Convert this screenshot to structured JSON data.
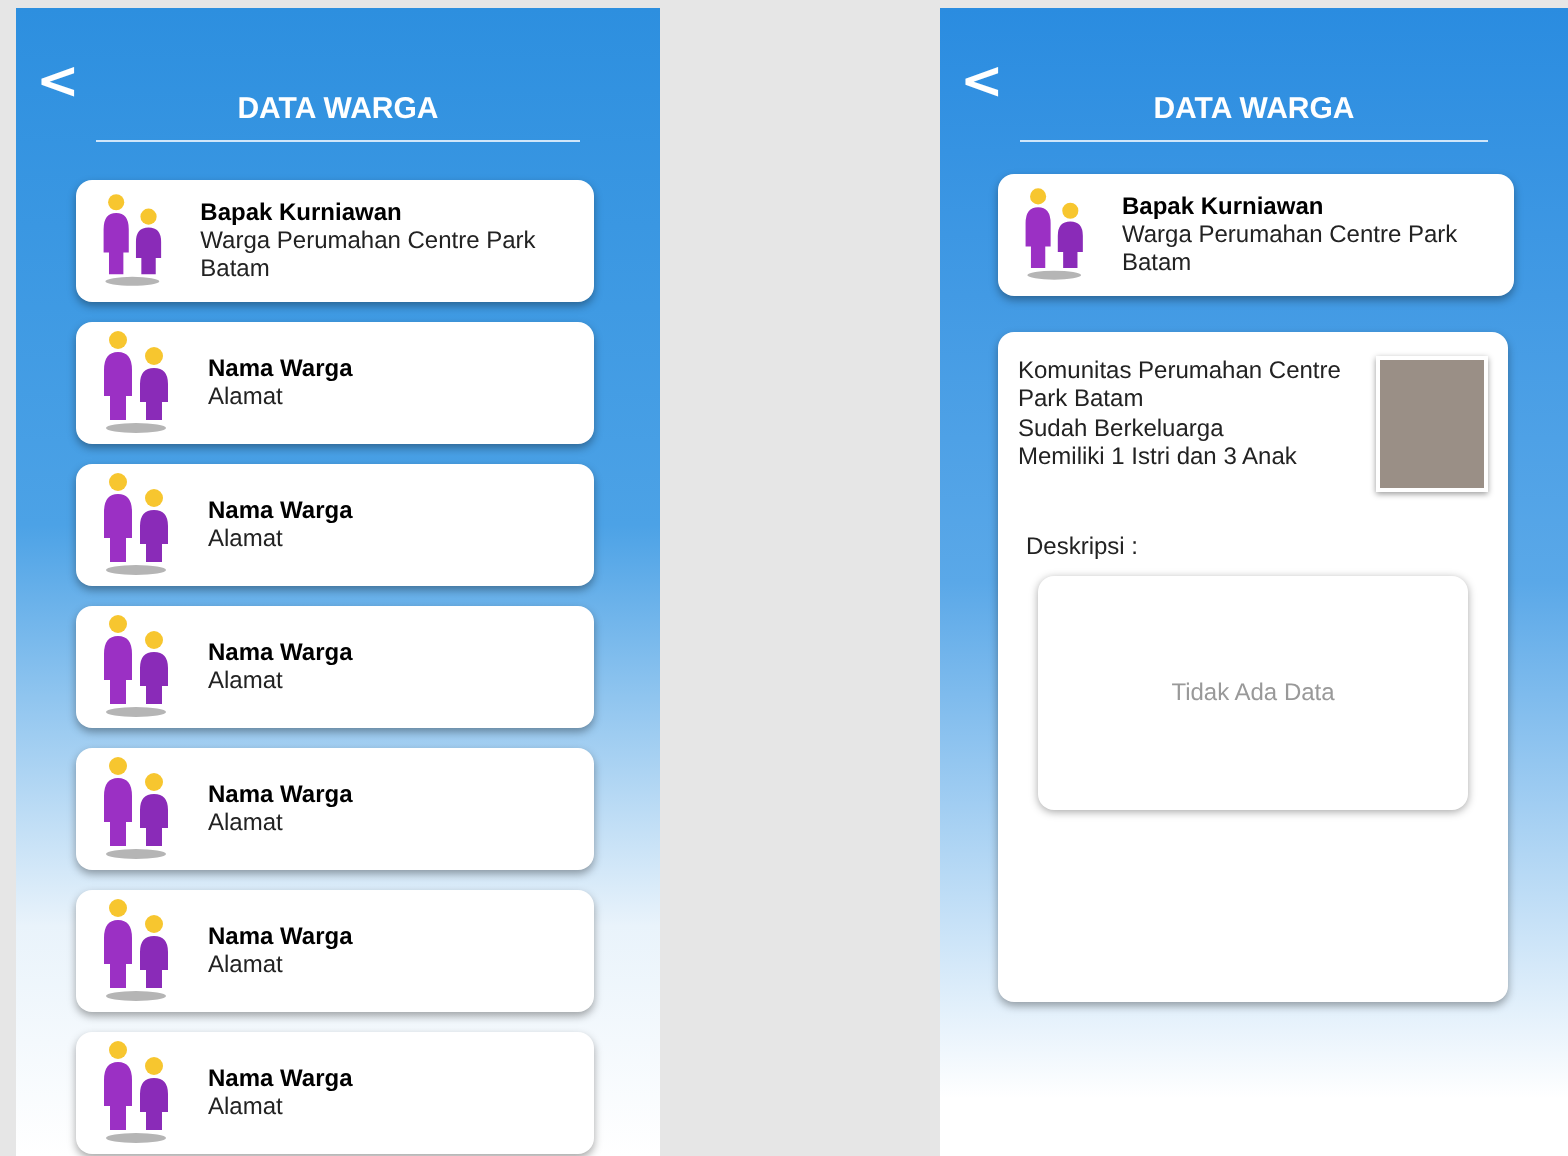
{
  "list_screen": {
    "back": "<",
    "title": "DATA WARGA",
    "residents": [
      {
        "name": "Bapak Kurniawan",
        "address": "Warga Perumahan Centre Park Batam"
      },
      {
        "name": "Nama Warga",
        "address": "Alamat"
      },
      {
        "name": "Nama Warga",
        "address": "Alamat"
      },
      {
        "name": "Nama Warga",
        "address": "Alamat"
      },
      {
        "name": "Nama Warga",
        "address": "Alamat"
      },
      {
        "name": "Nama Warga",
        "address": "Alamat"
      },
      {
        "name": "Nama Warga",
        "address": "Alamat"
      }
    ]
  },
  "detail_screen": {
    "back": "<",
    "title": "DATA WARGA",
    "resident": {
      "name": "Bapak Kurniawan",
      "address": "Warga Perumahan Centre Park Batam"
    },
    "info_lines": [
      "Komunitas Perumahan Centre Park Batam",
      "Sudah Berkeluarga",
      "Memiliki 1 Istri dan 3 Anak"
    ],
    "description_label": "Deskripsi :",
    "description_empty": "Tidak Ada Data"
  }
}
